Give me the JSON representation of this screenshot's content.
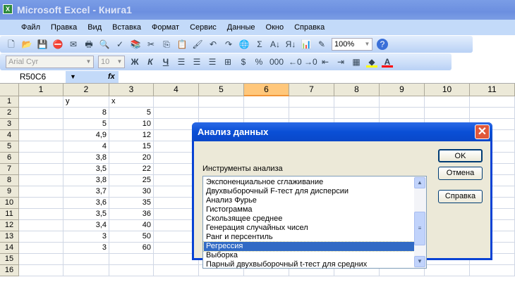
{
  "title": "Microsoft Excel - Книга1",
  "menu": [
    "Файл",
    "Правка",
    "Вид",
    "Вставка",
    "Формат",
    "Сервис",
    "Данные",
    "Окно",
    "Справка"
  ],
  "toolbar": {
    "zoom": "100%",
    "font": "Arial Cyr",
    "size": "10",
    "bold": "Ж",
    "italic": "К",
    "underline": "Ч",
    "percent": "%",
    "thousands": "000"
  },
  "namebox": "R50C6",
  "fx": "fx",
  "columns": [
    "1",
    "2",
    "3",
    "4",
    "5",
    "6",
    "7",
    "8",
    "9",
    "10",
    "11"
  ],
  "rows": [
    "1",
    "2",
    "3",
    "4",
    "5",
    "6",
    "7",
    "8",
    "9",
    "10",
    "11",
    "12",
    "13",
    "14",
    "15",
    "16"
  ],
  "cells": [
    [
      "y",
      "x"
    ],
    [
      "8",
      "5"
    ],
    [
      "5",
      "10"
    ],
    [
      "4,9",
      "12"
    ],
    [
      "4",
      "15"
    ],
    [
      "3,8",
      "20"
    ],
    [
      "3,5",
      "22"
    ],
    [
      "3,8",
      "25"
    ],
    [
      "3,7",
      "30"
    ],
    [
      "3,6",
      "35"
    ],
    [
      "3,5",
      "36"
    ],
    [
      "3,4",
      "40"
    ],
    [
      "3",
      "50"
    ],
    [
      "3",
      "60"
    ]
  ],
  "dialog": {
    "title": "Анализ данных",
    "label": "Инструменты анализа",
    "items": [
      "Экспоненциальное сглаживание",
      "Двухвыборочный F-тест для дисперсии",
      "Анализ Фурье",
      "Гистограмма",
      "Скользящее среднее",
      "Генерация случайных чисел",
      "Ранг и персентиль",
      "Регрессия",
      "Выборка",
      "Парный двухвыборочный t-тест для средних"
    ],
    "selected": "Регрессия",
    "ok": "OK",
    "cancel": "Отмена",
    "help": "Справка"
  }
}
